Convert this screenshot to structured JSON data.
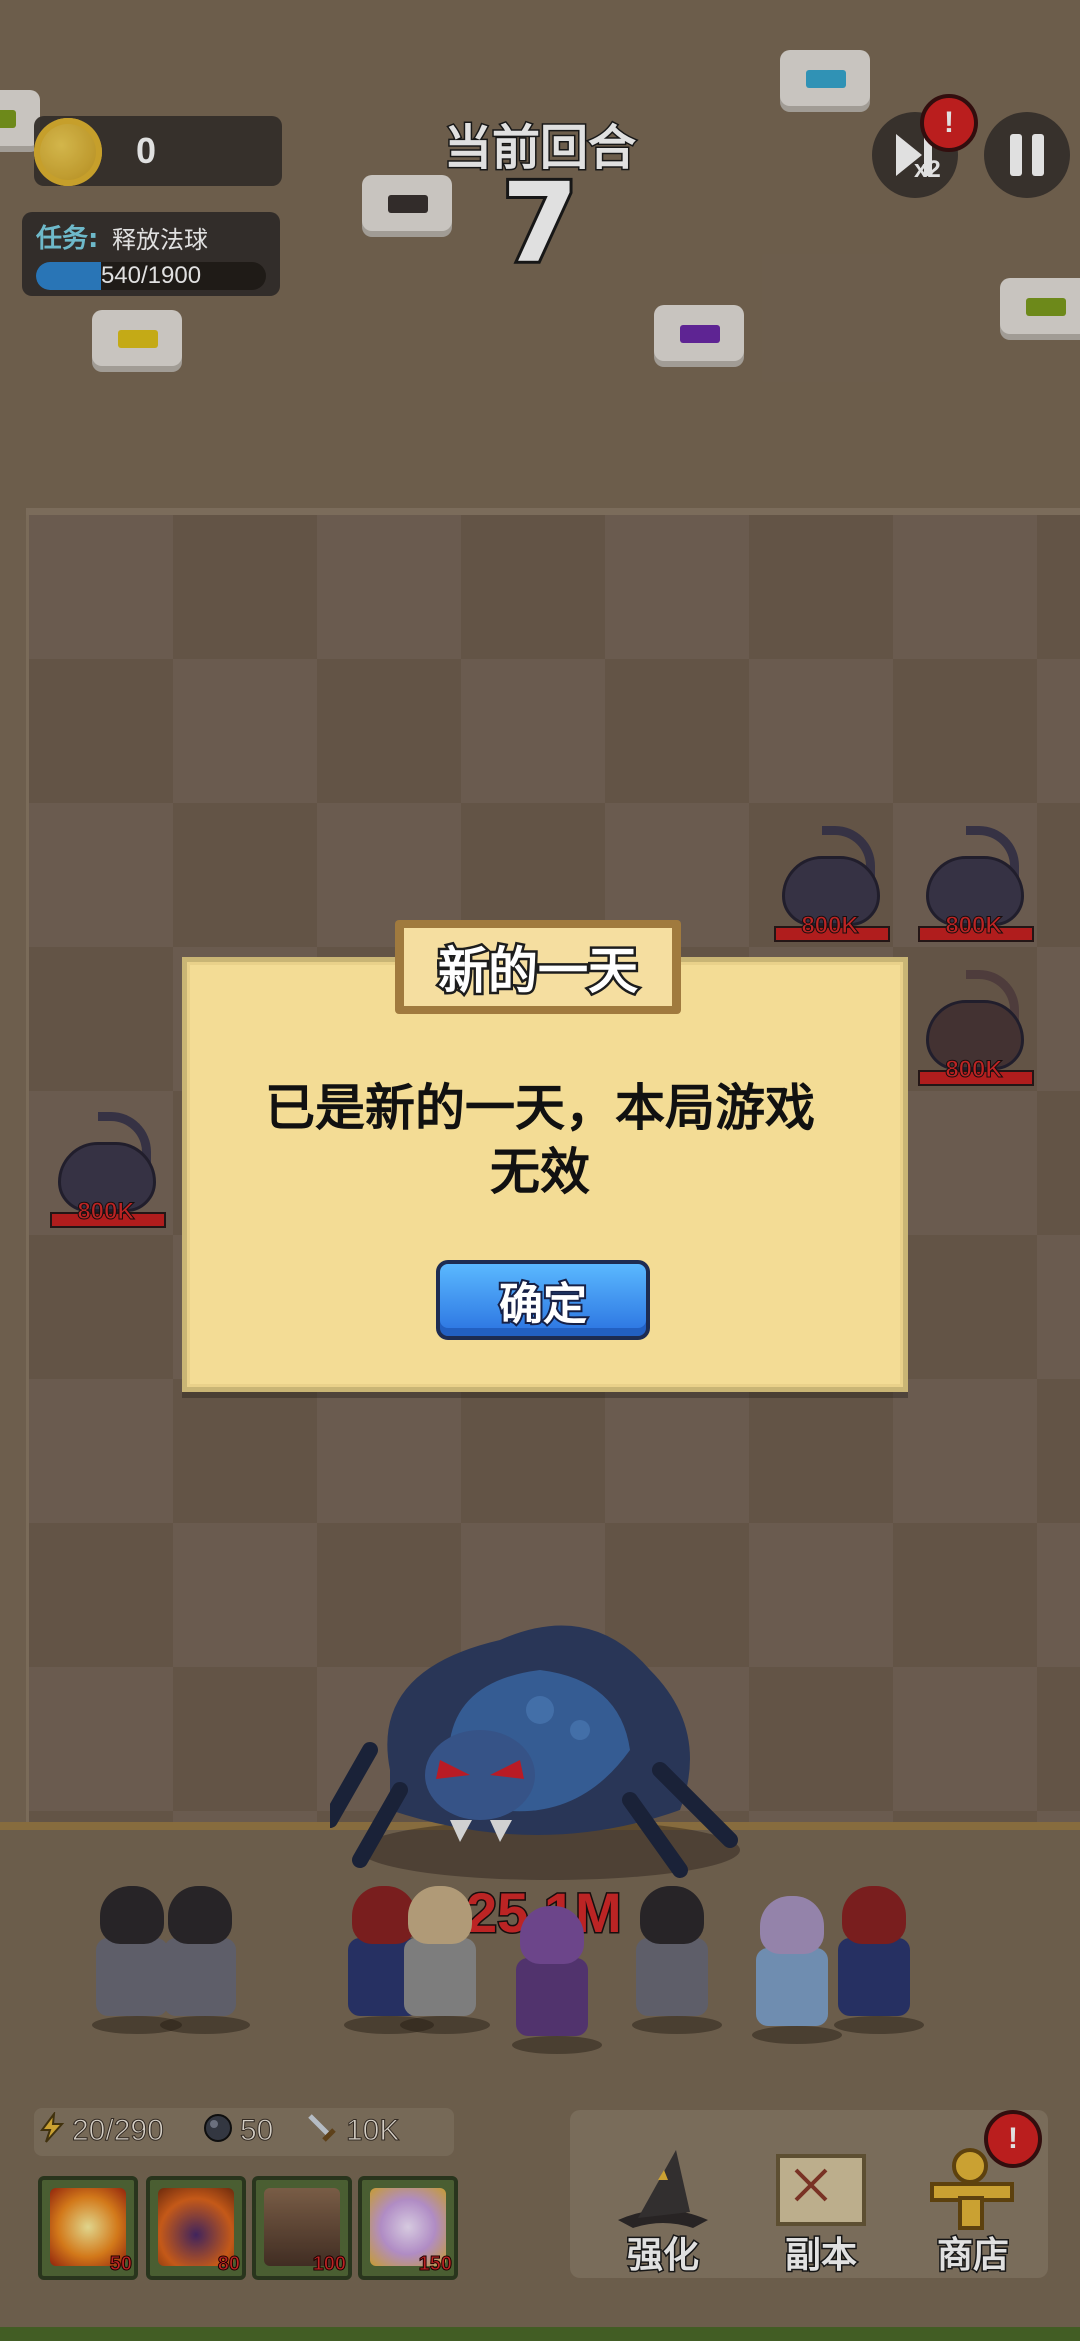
{
  "hud": {
    "coins": "0",
    "task": {
      "label": "任务:",
      "name": "释放法球",
      "progress_text": "540/1900",
      "current": 540,
      "total": 1900
    },
    "round_label": "当前回合",
    "round_number": "7",
    "speed_label": "x2",
    "alert_mark": "!"
  },
  "enemies": [
    {
      "hp": "800K"
    },
    {
      "hp": "800K"
    },
    {
      "hp": "800K"
    },
    {
      "hp": "800K"
    }
  ],
  "boss": {
    "hp": "25.1M"
  },
  "stats": {
    "energy": "20/290",
    "ore": "50",
    "attack": "10K"
  },
  "skills": [
    {
      "icon": "explosion-icon",
      "cost": "50"
    },
    {
      "icon": "fire-beast-icon",
      "cost": "80"
    },
    {
      "icon": "rock-spike-icon",
      "cost": "100"
    },
    {
      "icon": "angel-icon",
      "cost": "150"
    }
  ],
  "menu": {
    "upgrade": "强化",
    "dungeon": "副本",
    "shop": "商店"
  },
  "dialog": {
    "title": "新的一天",
    "message_line1": "已是新的一天，本局游戏",
    "message_line2": "无效",
    "confirm": "确定"
  },
  "colors": {
    "dialog_bg": "#f3dc95",
    "confirm_button": "#3b8ff0",
    "hp_red": "#d62a2a",
    "task_bar": "#2f86d0"
  }
}
